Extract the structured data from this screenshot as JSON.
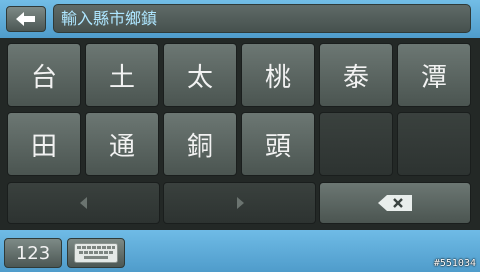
{
  "search": {
    "placeholder": "輸入縣市鄉鎮"
  },
  "keys_row1": [
    "台",
    "土",
    "太",
    "桃",
    "泰",
    "潭"
  ],
  "keys_row2": [
    "田",
    "通",
    "銅",
    "頭"
  ],
  "bottom": {
    "numeric_label": "123"
  },
  "watermark": "#551034"
}
